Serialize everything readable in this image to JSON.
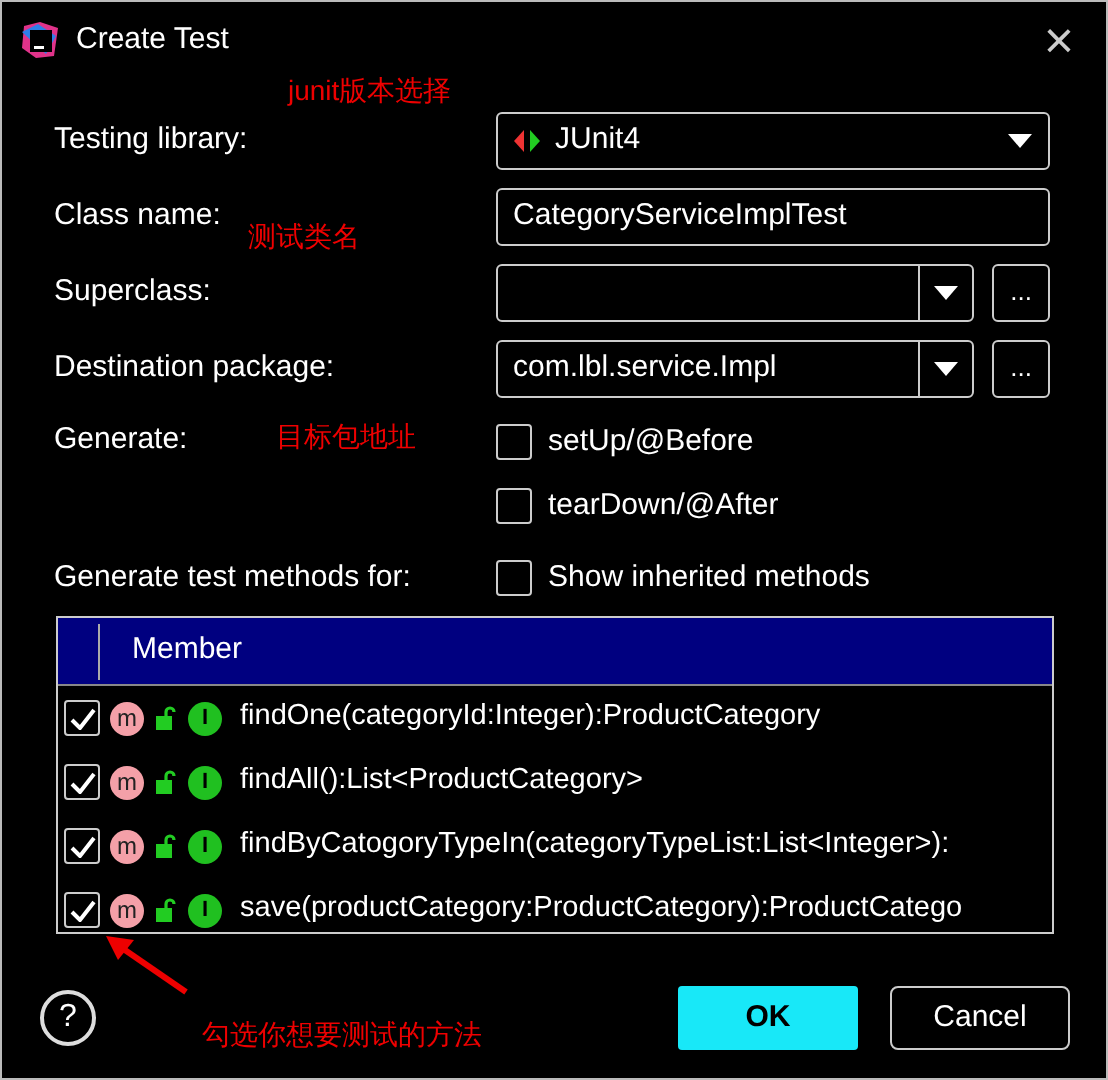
{
  "window": {
    "title": "Create Test",
    "close": "×"
  },
  "form": [
    {
      "kind": "select",
      "label": "Testing library:",
      "value": "JUnit4"
    },
    {
      "kind": "text",
      "label": "Class name:",
      "value": "CategoryServiceImplTest"
    },
    {
      "kind": "combo",
      "label": "Superclass:",
      "browse": "..."
    },
    {
      "kind": "combo",
      "label": "Destination package:",
      "value": "com.lbl.service.Impl",
      "browse": "..."
    }
  ],
  "generate": {
    "label": "Generate:",
    "options": [
      {
        "label": "setUp/@Before",
        "checked": false
      },
      {
        "label": "tearDown/@After",
        "checked": false
      }
    ]
  },
  "methods_for": {
    "label": "Generate test methods for:",
    "option": {
      "label": "Show inherited methods",
      "checked": false
    }
  },
  "table": {
    "columns": [
      "Member"
    ],
    "rows": [
      {
        "checked": true,
        "badge": "m",
        "impl_badge": "I",
        "signature": "findOne(categoryId:Integer):ProductCategory"
      },
      {
        "checked": true,
        "badge": "m",
        "impl_badge": "I",
        "signature": "findAll():List<ProductCategory>"
      },
      {
        "checked": true,
        "badge": "m",
        "impl_badge": "I",
        "signature": "findByCatogoryTypeIn(categoryTypeList:List<Integer>):"
      },
      {
        "checked": true,
        "badge": "m",
        "impl_badge": "I",
        "signature": "save(productCategory:ProductCategory):ProductCatego"
      }
    ]
  },
  "help": "?",
  "buttons": [
    {
      "label": "OK",
      "kind": "primary"
    },
    {
      "label": "Cancel",
      "kind": "secondary"
    }
  ],
  "annotations": [
    "junit版本选择",
    "测试类名",
    "目标包地址",
    "勾选你想要测试的方法"
  ]
}
